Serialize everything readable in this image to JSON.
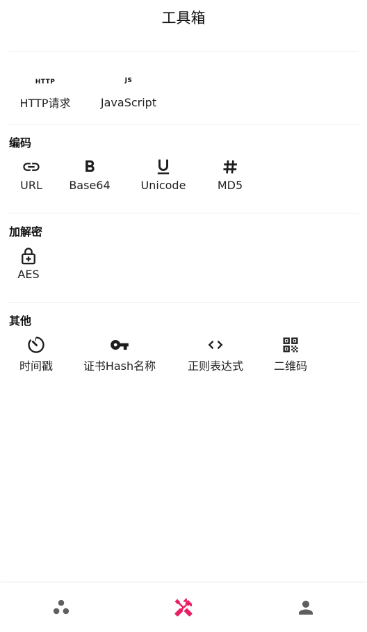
{
  "app": {
    "title": "工具箱"
  },
  "network": {
    "items": [
      {
        "label": "HTTP请求",
        "icon": "http-icon",
        "icon_text": "HTTP"
      },
      {
        "label": "JavaScript",
        "icon": "js-icon",
        "icon_text": "JS"
      }
    ]
  },
  "encoding": {
    "title": "编码",
    "items": [
      {
        "label": "URL",
        "icon": "link-icon"
      },
      {
        "label": "Base64",
        "icon": "bold-b-icon"
      },
      {
        "label": "Unicode",
        "icon": "underline-u-icon"
      },
      {
        "label": "MD5",
        "icon": "hash-icon"
      }
    ]
  },
  "crypto": {
    "title": "加解密",
    "items": [
      {
        "label": "AES",
        "icon": "lock-plus-icon"
      }
    ]
  },
  "other": {
    "title": "其他",
    "items": [
      {
        "label": "时间戳",
        "icon": "timer-icon"
      },
      {
        "label": "证书Hash名称",
        "icon": "key-icon"
      },
      {
        "label": "正则表达式",
        "icon": "code-brackets-icon"
      },
      {
        "label": "二维码",
        "icon": "qr-code-icon"
      }
    ]
  },
  "bottom_nav": {
    "items": [
      {
        "icon": "circles-icon",
        "active": false
      },
      {
        "icon": "tools-icon",
        "active": true
      },
      {
        "icon": "person-icon",
        "active": false
      }
    ],
    "active_color": "#e91e63",
    "inactive_color": "#5f5f5f"
  }
}
